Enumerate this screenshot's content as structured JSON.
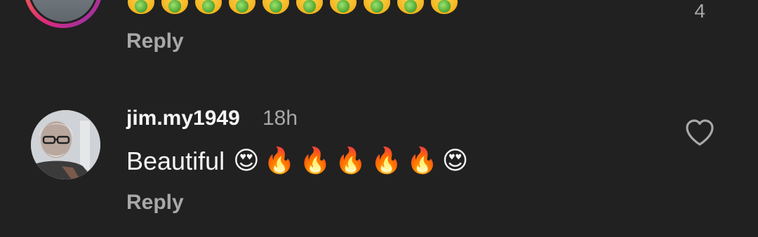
{
  "previous_comment": {
    "emojis": [
      "nauseated-face",
      "nauseated-face",
      "nauseated-face",
      "nauseated-face",
      "nauseated-face",
      "nauseated-face",
      "nauseated-face",
      "nauseated-face",
      "nauseated-face",
      "nauseated-face"
    ],
    "like_count": "4",
    "reply_label": "Reply"
  },
  "comment": {
    "username": "jim.my1949",
    "time": "18h",
    "text": "Beautiful",
    "emojis": [
      "😍",
      "🔥",
      "🔥",
      "🔥",
      "🔥",
      "🔥",
      "😍"
    ],
    "reply_label": "Reply",
    "like_icon": "heart-outline-icon"
  },
  "colors": {
    "background": "#212121",
    "secondary_text": "#a8a8a8",
    "primary_text": "#f5f5f5"
  }
}
